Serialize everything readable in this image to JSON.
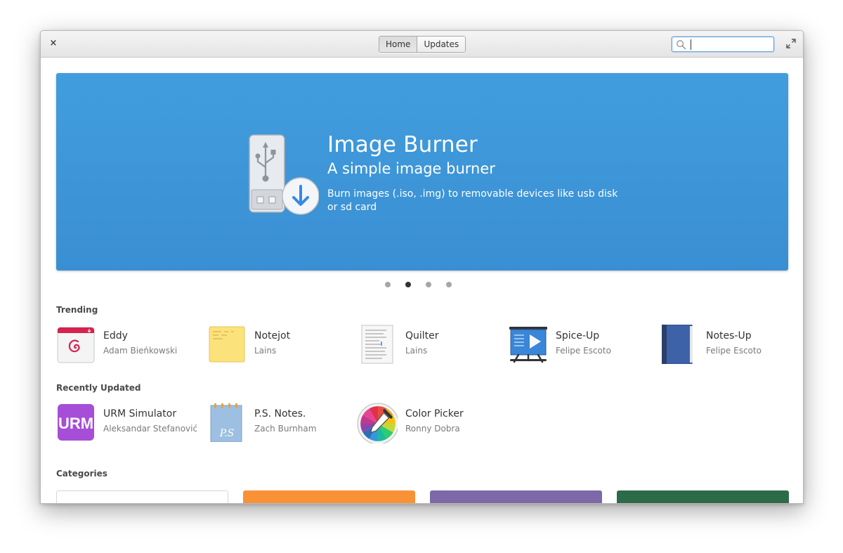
{
  "titlebar": {
    "close_glyph": "×",
    "tabs": [
      {
        "label": "Home",
        "active": true
      },
      {
        "label": "Updates",
        "active": false
      }
    ],
    "search": {
      "value": "",
      "placeholder": ""
    }
  },
  "banner": {
    "title": "Image Burner",
    "subtitle": "A simple image burner",
    "description": "Burn images (.iso, .img) to removable devices like usb disk or sd card",
    "background": "#3f98da",
    "dots_count": 4,
    "active_dot": 1
  },
  "trending": {
    "header": "Trending",
    "apps": [
      {
        "name": "Eddy",
        "author": "Adam Bieńkowski",
        "icon": "eddy-icon"
      },
      {
        "name": "Notejot",
        "author": "Lains",
        "icon": "notejot-icon"
      },
      {
        "name": "Quilter",
        "author": "Lains",
        "icon": "quilter-icon"
      },
      {
        "name": "Spice-Up",
        "author": "Felipe Escoto",
        "icon": "spice-up-icon"
      },
      {
        "name": "Notes-Up",
        "author": "Felipe Escoto",
        "icon": "notes-up-icon"
      }
    ]
  },
  "recently_updated": {
    "header": "Recently Updated",
    "apps": [
      {
        "name": "URM Simulator",
        "author": "Aleksandar Stefanović",
        "icon": "urm-simulator-icon",
        "icon_text": "URM"
      },
      {
        "name": "P.S. Notes.",
        "author": "Zach Burnham",
        "icon": "ps-notes-icon",
        "icon_text": "P.S"
      },
      {
        "name": "Color Picker",
        "author": "Ronny Dobra",
        "icon": "color-picker-icon"
      }
    ]
  },
  "categories": {
    "header": "Categories",
    "colors": [
      "#ffffff",
      "#f99237",
      "#7d68a8",
      "#2d6a48"
    ]
  }
}
